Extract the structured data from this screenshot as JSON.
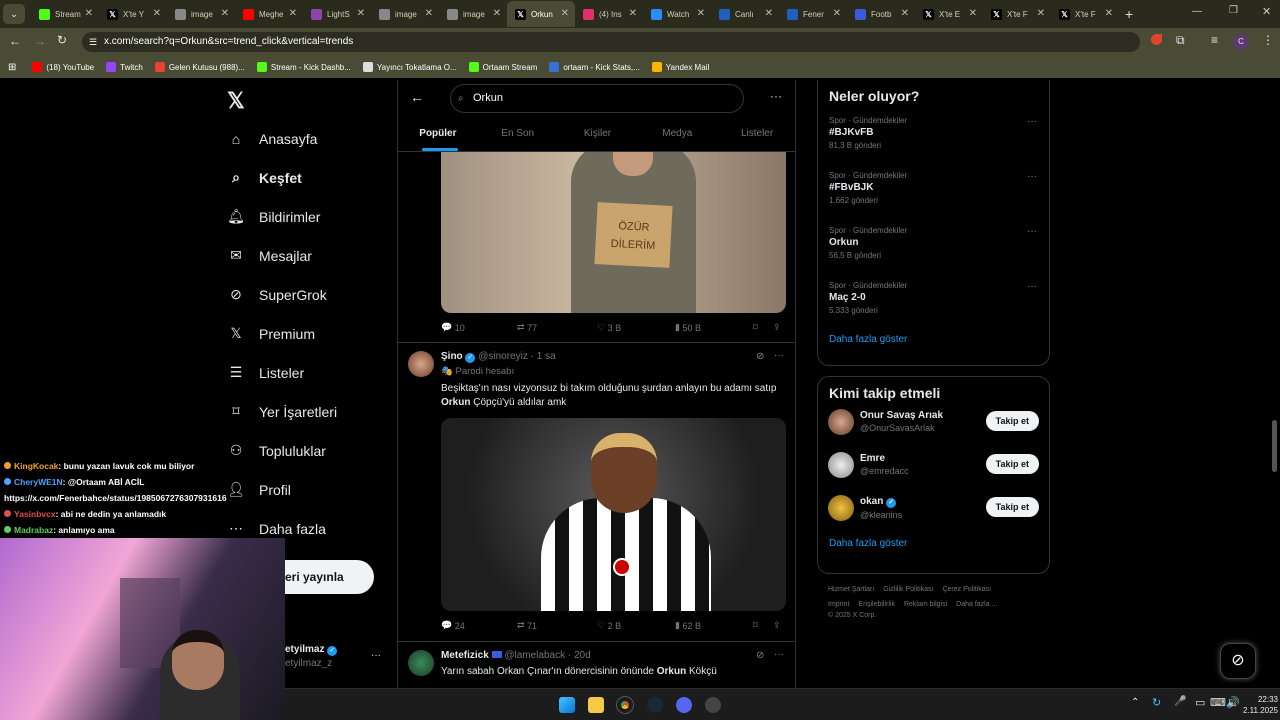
{
  "browser": {
    "tabs": [
      {
        "label": "Stream",
        "icon": "kick-icon",
        "color": "#53fc18"
      },
      {
        "label": "X'te Y",
        "icon": "x-icon",
        "color": "#000000"
      },
      {
        "label": "image",
        "icon": "globe-icon",
        "color": "#888888"
      },
      {
        "label": "Meghe",
        "icon": "youtube-icon",
        "color": "#ff0000"
      },
      {
        "label": "LightS",
        "icon": "lightshot-icon",
        "color": "#8e44ad"
      },
      {
        "label": "image",
        "icon": "globe-icon",
        "color": "#888888"
      },
      {
        "label": "image",
        "icon": "globe-icon",
        "color": "#888888"
      },
      {
        "label": "Orkun",
        "icon": "x-icon",
        "color": "#000000"
      },
      {
        "label": "(4) Ins",
        "icon": "instagram-icon",
        "color": "#e1306c"
      },
      {
        "label": "Watch",
        "icon": "watch-icon",
        "color": "#2b8cff"
      },
      {
        "label": "Canlı",
        "icon": "mackolik-icon",
        "color": "#1f5fbf"
      },
      {
        "label": "Fener",
        "icon": "mackolik-icon",
        "color": "#1f5fbf"
      },
      {
        "label": "Footb",
        "icon": "football-icon",
        "color": "#3b5bdb"
      },
      {
        "label": "X'te E",
        "icon": "x-icon",
        "color": "#000000"
      },
      {
        "label": "X'te F",
        "icon": "x-icon",
        "color": "#000000"
      },
      {
        "label": "X'te F",
        "icon": "x-icon",
        "color": "#000000"
      }
    ],
    "url": "x.com/search?q=Orkun&src=trend_click&vertical=trends",
    "profile_initial": "C",
    "bookmarks": [
      {
        "label": "(18) YouTube",
        "color": "#ff0000"
      },
      {
        "label": "Twitch",
        "color": "#9146ff"
      },
      {
        "label": "Gelen Kutusu (988)...",
        "color": "#ea4335"
      },
      {
        "label": "Stream - Kick Dashb...",
        "color": "#53fc18"
      },
      {
        "label": "Yayıncı Tokatlama O...",
        "color": "#dddddd"
      },
      {
        "label": "Ortaam Stream",
        "color": "#53fc18"
      },
      {
        "label": "ortaam - Kick Stats,...",
        "color": "#3a6ed8"
      },
      {
        "label": "Yandex Mail",
        "color": "#ffb400"
      }
    ]
  },
  "nav": {
    "items": [
      {
        "label": "Anasayfa",
        "icon": "home-icon"
      },
      {
        "label": "Keşfet",
        "icon": "search-icon"
      },
      {
        "label": "Bildirimler",
        "icon": "bell-icon"
      },
      {
        "label": "Mesajlar",
        "icon": "mail-icon"
      },
      {
        "label": "SuperGrok",
        "icon": "grok-icon"
      },
      {
        "label": "Premium",
        "icon": "x-icon"
      },
      {
        "label": "Listeler",
        "icon": "list-icon"
      },
      {
        "label": "Yer İşaretleri",
        "icon": "bookmark-icon"
      },
      {
        "label": "Topluluklar",
        "icon": "community-icon"
      },
      {
        "label": "Profil",
        "icon": "person-icon"
      },
      {
        "label": "Daha fazla",
        "icon": "more-icon"
      }
    ],
    "post_button": "eri yayınla",
    "account_name": "etyilmaz",
    "account_handle": "etyilmaz_z"
  },
  "search": {
    "query": "Orkun",
    "tabs": [
      "Popüler",
      "En Son",
      "Kişiler",
      "Medya",
      "Listeler"
    ]
  },
  "tweets": [
    {
      "image_text": "ÖZÜR DİLERİM",
      "replies": "10",
      "reposts": "77",
      "likes": "3 B",
      "views": "50 B"
    },
    {
      "name": "Şino",
      "handle": "@sinoreyiz",
      "time": "· 1 sa",
      "badge": "Parodi hesabı",
      "text_pre": "Beşiktaş'ın nası vizyonsuz bi takım olduğunu şurdan anlayın bu adamı satıp ",
      "text_bold": "Orkun",
      "text_post": " Çöpçü'yü aldılar amk",
      "replies": "24",
      "reposts": "71",
      "likes": "2 B",
      "views": "62 B"
    },
    {
      "name": "Metefizick",
      "handle": "@lamelaback",
      "time": "· 20d",
      "text_pre": "Yarın sabah Orkan Çınar'ın dönercisinin önünde ",
      "text_bold": "Orkun",
      "text_post": " Kökçü"
    }
  ],
  "trends": {
    "title": "Neler oluyor?",
    "items": [
      {
        "category": "Spor · Gündemdekiler",
        "name": "#BJKvFB",
        "count": "81,3 B gönderi"
      },
      {
        "category": "Spor · Gündemdekiler",
        "name": "#FBvBJK",
        "count": "1.662 gönderi"
      },
      {
        "category": "Spor · Gündemdekiler",
        "name": "Orkun",
        "count": "56,5 B gönderi"
      },
      {
        "category": "Spor · Gündemdekiler",
        "name": "Maç 2-0",
        "count": "5.333 gönderi"
      }
    ],
    "show_more": "Daha fazla göster"
  },
  "who_to_follow": {
    "title": "Kimi takip etmeli",
    "users": [
      {
        "name": "Onur Savaş Arıak",
        "handle": "@OnurSavasArlak",
        "button": "Takip et"
      },
      {
        "name": "Emre",
        "handle": "@emredacc",
        "button": "Takip et"
      },
      {
        "name": "okan",
        "handle": "@kleanins",
        "button": "Takip et"
      }
    ],
    "show_more": "Daha fazla göster"
  },
  "footer": {
    "links": [
      "Hizmet Şartları",
      "Gizlilik Politikası",
      "Çerez Politikası",
      "Imprint",
      "Erişilebilirlik",
      "Reklam bilgisi",
      "Daha fazla ..."
    ],
    "copyright": "© 2025 X Corp."
  },
  "chat": [
    {
      "user": "KingKocak",
      "color": "#f0a030",
      "message": ": bunu yazan lavuk cok mu biliyor"
    },
    {
      "user": "CheryWE1N",
      "color": "#4fa3ff",
      "message": ": @Ortaam ABİ ACİL"
    },
    {
      "user": "",
      "color": "#ffffff",
      "message": "https://x.com/Fenerbahce/status/1985067276307931616"
    },
    {
      "user": "Yasinbvcx",
      "color": "#e05050",
      "message": ": abi ne dedin ya anlamadık"
    },
    {
      "user": "Madrabaz",
      "color": "#60d060",
      "message": ": anlamıyo ama"
    }
  ],
  "taskbar": {
    "time": "22:33",
    "date": "2.11.2025"
  }
}
